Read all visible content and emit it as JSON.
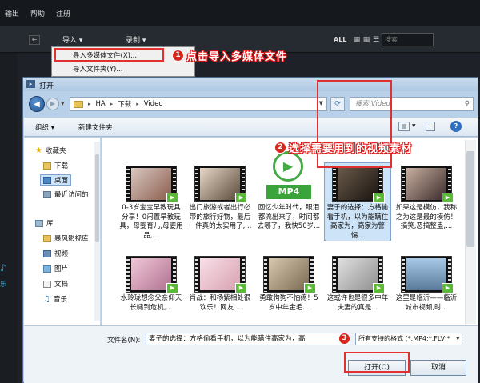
{
  "app": {
    "menu": [
      "输出",
      "帮助",
      "注册"
    ],
    "import_label": "导入",
    "record_label": "录制",
    "all_label": "ALL",
    "search_placeholder": "搜索",
    "music_label": "乐",
    "import_menu": [
      "导入多媒体文件(X)...",
      "导入文件夹(Y)..."
    ]
  },
  "annotations": [
    {
      "num": "1",
      "text": "点击导入多媒体文件"
    },
    {
      "num": "2",
      "text": "选择需要用到的视频素材"
    },
    {
      "num": "3",
      "text": ""
    }
  ],
  "dialog": {
    "title": "打开",
    "path": [
      "HA",
      "下载",
      "Video"
    ],
    "search_placeholder": "搜索 Video",
    "toolbar": {
      "organize": "组织 ▾",
      "new_folder": "新建文件夹"
    },
    "nav": [
      {
        "label": "收藏夹",
        "icon": "star-icon"
      },
      {
        "label": "下载",
        "icon": "folder-icon"
      },
      {
        "label": "桌面",
        "icon": "desktop-icon"
      },
      {
        "label": "最近访问的",
        "icon": "recent-icon"
      },
      {
        "label": "库",
        "icon": "library-icon"
      },
      {
        "label": "暴风影视库",
        "icon": "folder-icon"
      },
      {
        "label": "视频",
        "icon": "video-icon"
      },
      {
        "label": "图片",
        "icon": "picture-icon"
      },
      {
        "label": "文档",
        "icon": "document-icon"
      },
      {
        "label": "音乐",
        "icon": "music-icon"
      }
    ],
    "files": [
      {
        "name": "0-3岁宝宝早教玩具分享！0闲置早教玩具，母婴育儿,母婴用品,..."
      },
      {
        "name": "出门旅游或者出行必带的旅行好物，最后一件真的太实用了,..."
      },
      {
        "name": "回忆少年时代，眼泪都流出来了，时间都去哪了，我快50岁..."
      },
      {
        "name": "妻子的选择：方格偷看手机，以为能瞒住高家为，高家为警惕..."
      },
      {
        "name": "如果这是模仿，我称之为这是最的模仿！搞笑,恶搞整蛊,..."
      },
      {
        "name": "水玲珑想念父亲仰天长啸到危机,..."
      },
      {
        "name": "肖战：和杨紫相处很欢乐！网友..."
      },
      {
        "name": "勇敢狗狗不怕疼！5岁中年金毛..."
      },
      {
        "name": "这或许也是很多中年夫妻的真是..."
      },
      {
        "name": "这里是临沂——临沂城市视频,时..."
      }
    ],
    "mp4_label": "MP4",
    "filename_label": "文件名(N):",
    "filename_value": "妻子的选择：方格偷看手机，以为能瞒住高家为，高",
    "filetype_value": "所有支持的格式 (*.MP4;*.FLV;*",
    "open_label": "打开(O)",
    "cancel_label": "取消"
  }
}
